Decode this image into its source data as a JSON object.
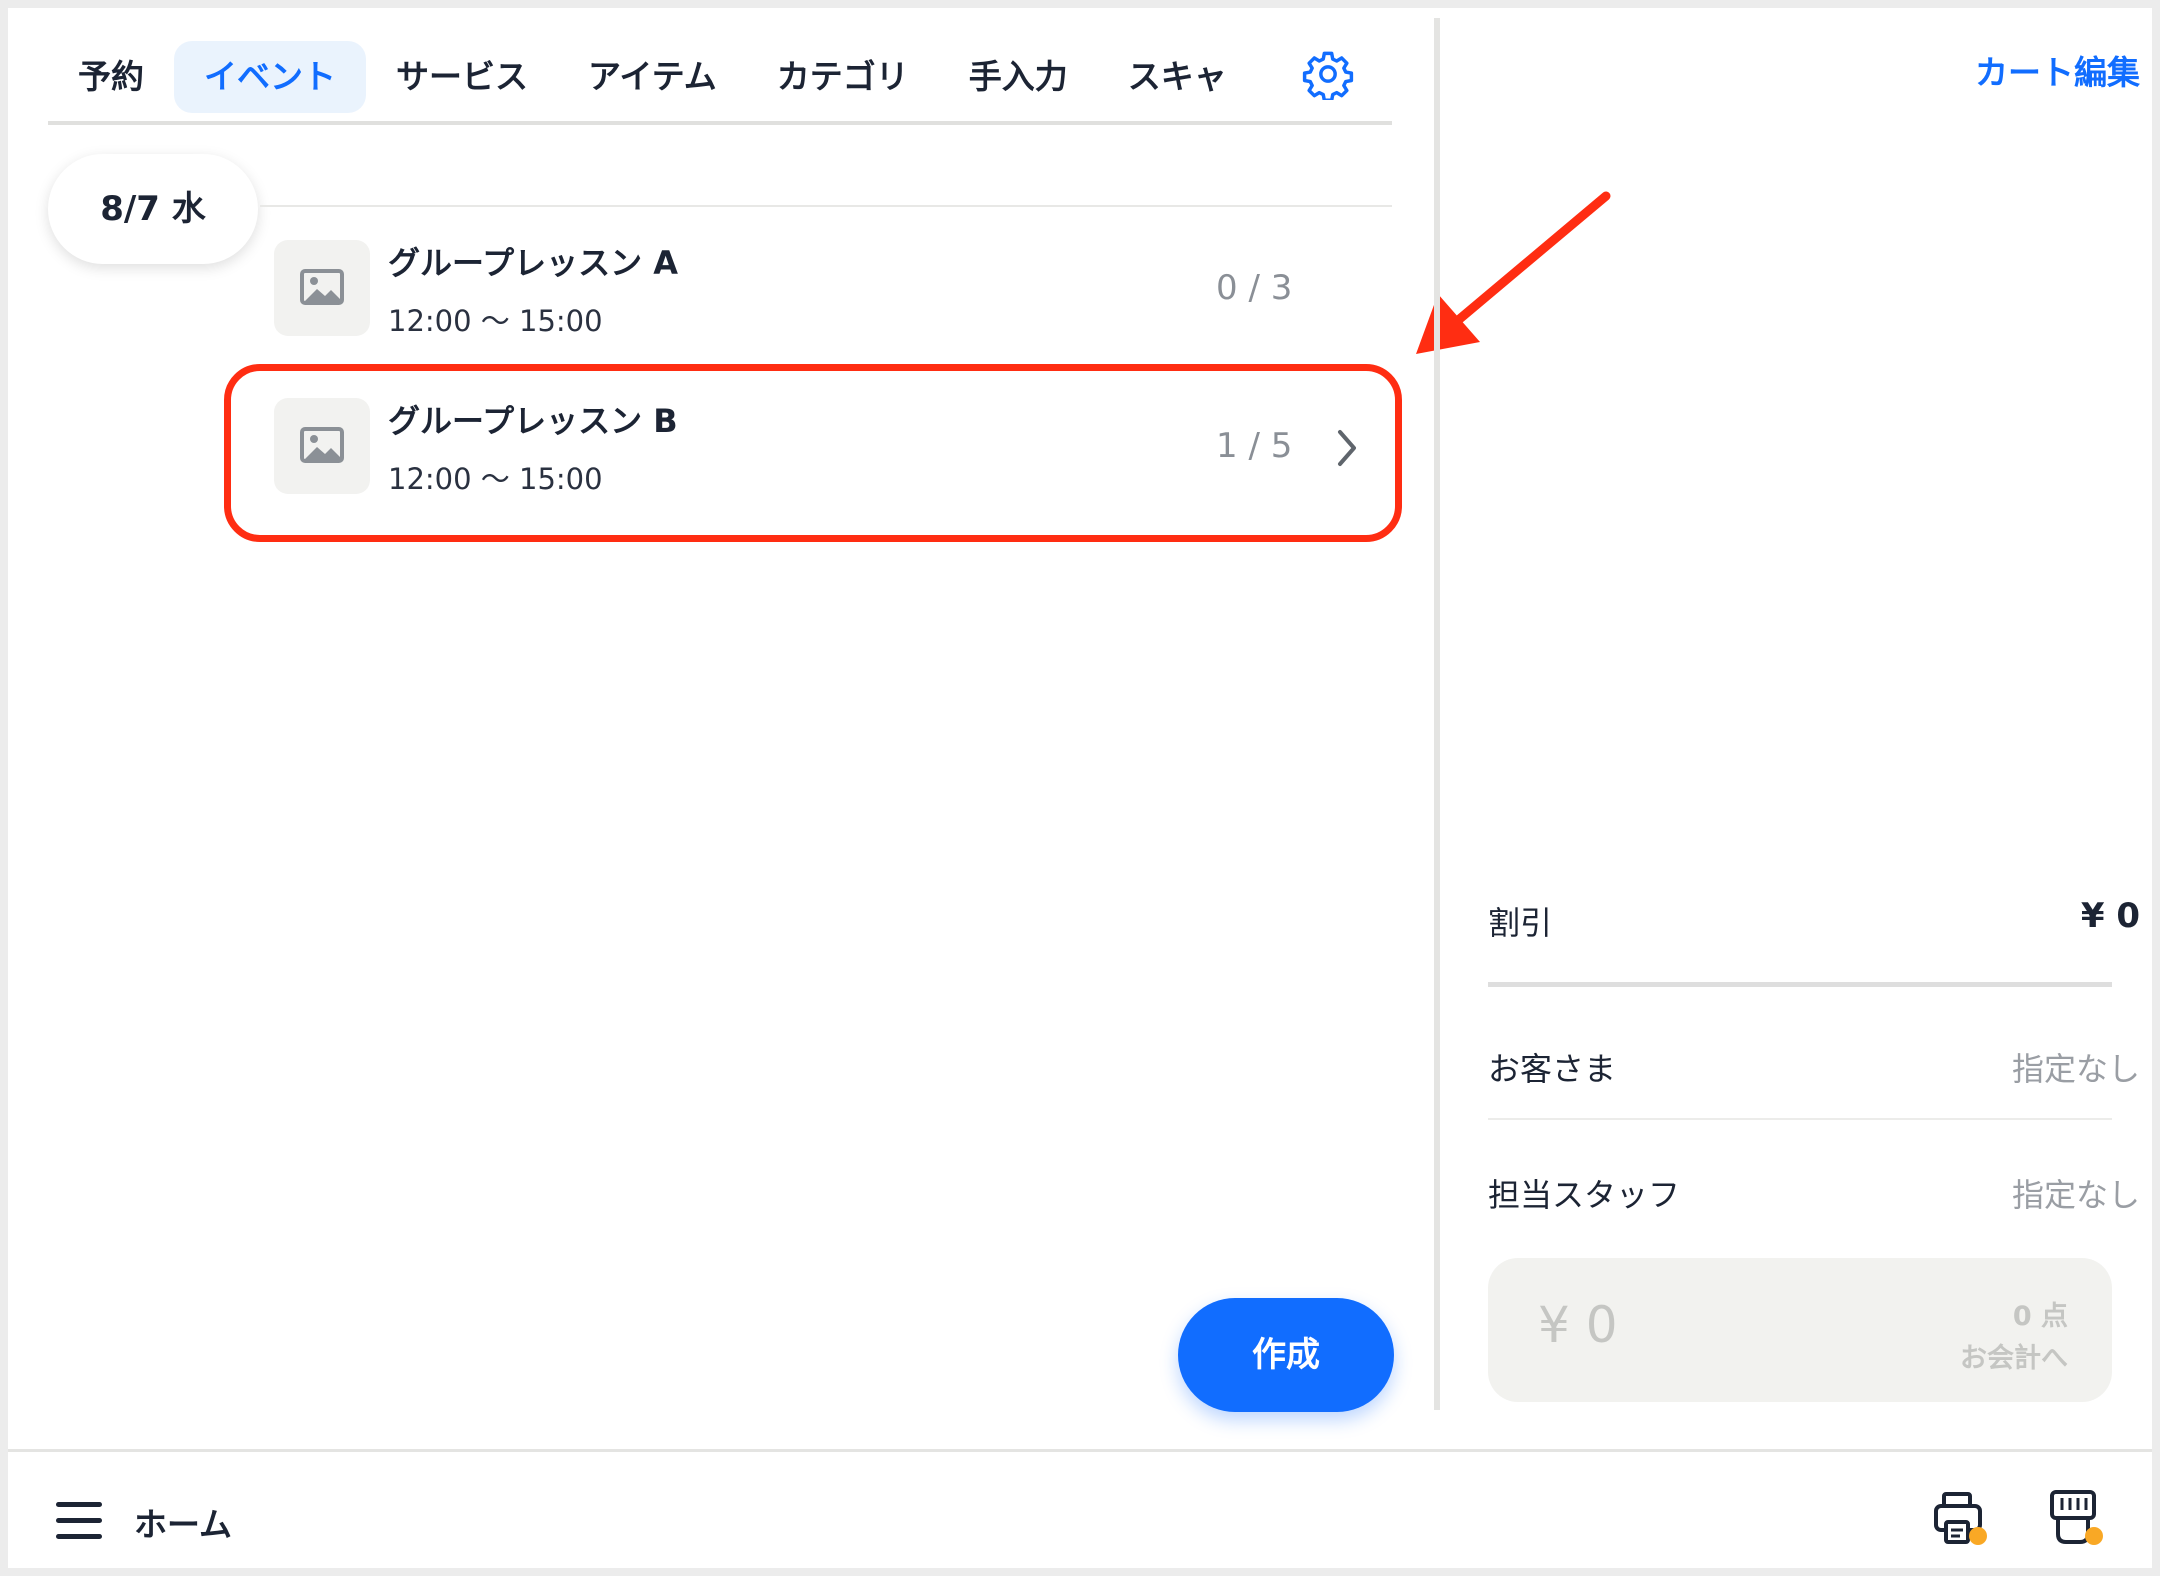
{
  "tabs": [
    {
      "label": "予約"
    },
    {
      "label": "イベント"
    },
    {
      "label": "サービス"
    },
    {
      "label": "アイテム"
    },
    {
      "label": "カテゴリ"
    },
    {
      "label": "手入力"
    },
    {
      "label": "スキャ"
    }
  ],
  "active_tab": "イベント",
  "date_pill": "8/7 水",
  "events": [
    {
      "name": "グループレッスン A",
      "time": "12:00 〜 15:00",
      "count": "0 / 3"
    },
    {
      "name": "グループレッスン B",
      "time": "12:00 〜 15:00",
      "count": "1 / 5"
    }
  ],
  "create_button": "作成",
  "cart": {
    "edit_label": "カート編集",
    "discount_label": "割引",
    "discount_value": "¥ 0",
    "customer_label": "お客さま",
    "customer_value": "指定なし",
    "staff_label": "担当スタッフ",
    "staff_value": "指定なし",
    "checkout_amount": "¥ 0",
    "checkout_count": "0 点",
    "checkout_label": "お会計へ"
  },
  "bottom": {
    "home_label": "ホーム"
  },
  "colors": {
    "accent": "#116dff",
    "highlight": "#ff2d12",
    "badge": "#f9a825"
  }
}
